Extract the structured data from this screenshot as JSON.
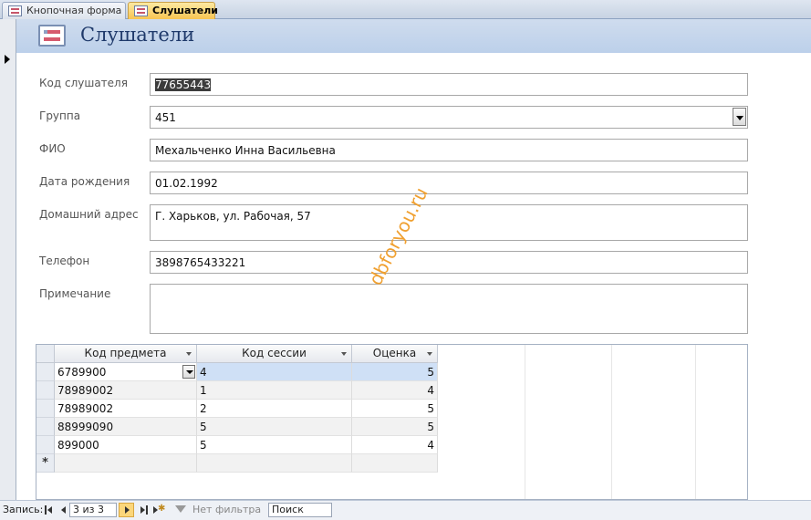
{
  "tabs": [
    {
      "label": "Кнопочная форма",
      "active": false
    },
    {
      "label": "Слушатели",
      "active": true
    }
  ],
  "form": {
    "title": "Слушатели",
    "fields": [
      {
        "label": "Код слушателя",
        "value": "77655443"
      },
      {
        "label": "Группа",
        "value": "451"
      },
      {
        "label": "ФИО",
        "value": "Мехальченко Инна Васильевна"
      },
      {
        "label": "Дата рождения",
        "value": "01.02.1992"
      },
      {
        "label": "Домашний адрес",
        "value": "Г. Харьков, ул. Рабочая, 57"
      },
      {
        "label": "Телефон",
        "value": "3898765433221"
      },
      {
        "label": "Примечание",
        "value": ""
      }
    ]
  },
  "watermark": "dbforyou.ru",
  "subform": {
    "columns": [
      "Код предмета",
      "Код сессии",
      "Оценка"
    ],
    "rows": [
      [
        "6789900",
        "4",
        "5"
      ],
      [
        "78989002",
        "1",
        "4"
      ],
      [
        "78989002",
        "2",
        "5"
      ],
      [
        "88999090",
        "5",
        "5"
      ],
      [
        "899000",
        "5",
        "4"
      ]
    ],
    "new_row_marker": "*"
  },
  "navbar": {
    "label": "Запись:",
    "counter": "3 из 3",
    "filter": "Нет фильтра",
    "search": "Поиск"
  },
  "colors": {
    "header_bg": "#bcd0ea",
    "active_tab": "#f7c452",
    "watermark": "#f0a030",
    "selection": "#cfe0f6"
  }
}
